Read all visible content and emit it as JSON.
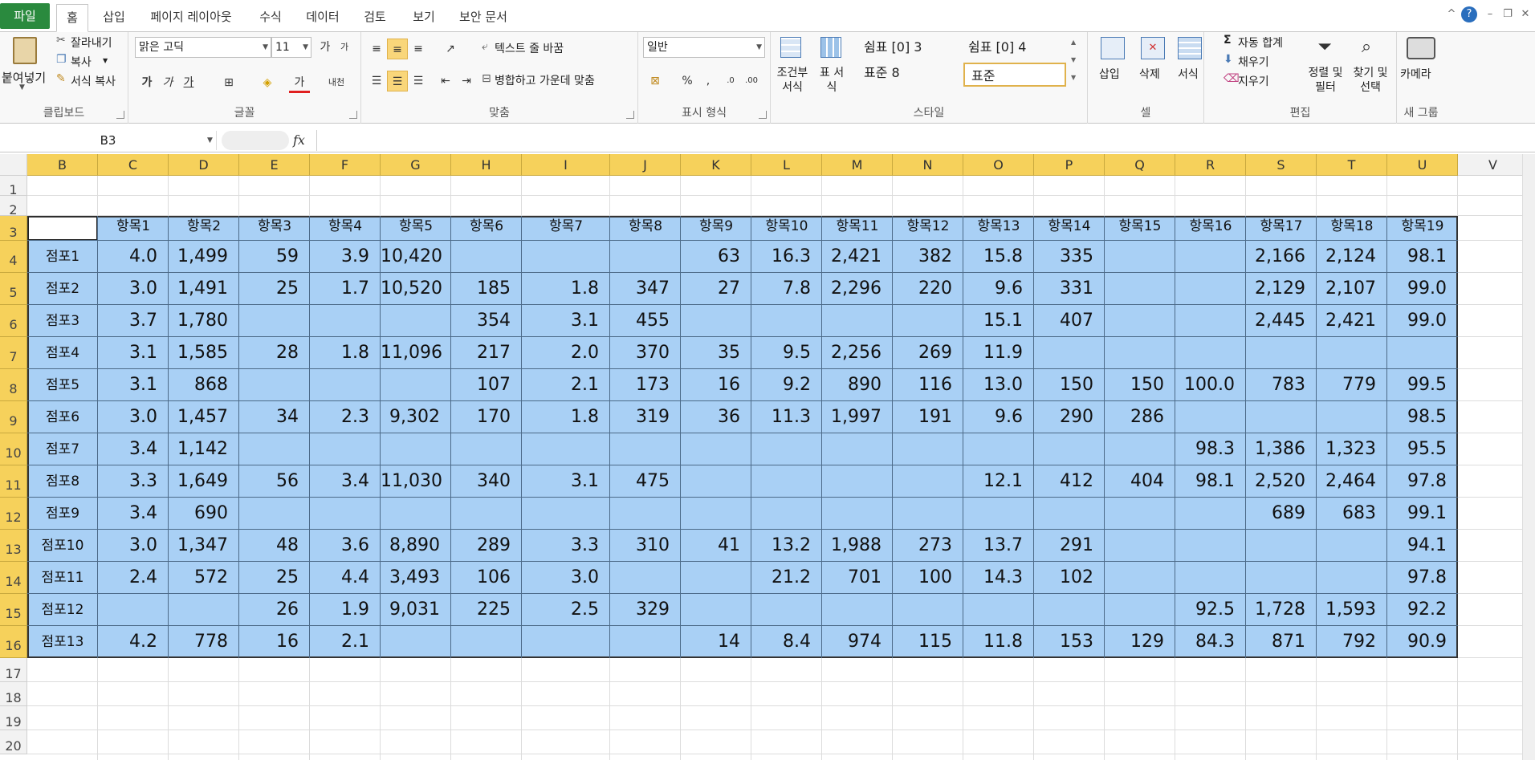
{
  "tabs": [
    "파일",
    "홈",
    "삽입",
    "페이지 레이아웃",
    "수식",
    "데이터",
    "검토",
    "보기",
    "보안 문서"
  ],
  "ribbon": {
    "clipboard": {
      "paste": "붙여넣기",
      "cut": "잘라내기",
      "copy": "복사",
      "format_painter": "서식 복사",
      "label": "클립보드"
    },
    "font": {
      "name": "맑은 고딕",
      "size": "11",
      "label": "글꼴",
      "bold": "가",
      "italic": "가",
      "underline": "가",
      "font_color_glyph": "가",
      "phonetic": "내천"
    },
    "align": {
      "wrap": "텍스트 줄 바꿈",
      "merge": "병합하고 가운데 맞춤",
      "label": "맞춤"
    },
    "number": {
      "format": "일반",
      "percent": "%",
      "comma": ",",
      "label": "표시 형식"
    },
    "styles": {
      "cond": "조건부 서식",
      "table": "표 서식",
      "s1": "쉼표 [0] 3",
      "s2": "쉼표 [0] 4",
      "s3": "표준 8",
      "s4": "표준",
      "label": "스타일"
    },
    "cells": {
      "insert": "삽입",
      "delete": "삭제",
      "format": "서식",
      "label": "셀"
    },
    "edit": {
      "autosum": "자동 합계",
      "fill": "채우기",
      "clear": "지우기",
      "sort": "정렬 및 필터",
      "find": "찾기 및 선택",
      "label": "편집"
    },
    "newgroup": {
      "camera": "카메라",
      "label": "새 그룹"
    }
  },
  "formula": {
    "namebox": "B3",
    "fx": "fx",
    "value": ""
  },
  "columns": [
    "B",
    "C",
    "D",
    "E",
    "F",
    "G",
    "H",
    "I",
    "J",
    "K",
    "L",
    "M",
    "N",
    "O",
    "P",
    "Q",
    "R",
    "S",
    "T",
    "U",
    "V"
  ],
  "rows": [
    "1",
    "2",
    "3",
    "4",
    "5",
    "6",
    "7",
    "8",
    "9",
    "10",
    "11",
    "12",
    "13",
    "14",
    "15",
    "16",
    "17",
    "18",
    "19",
    "20"
  ],
  "header_row": [
    "",
    "항목1",
    "항목2",
    "항목3",
    "항목4",
    "항목5",
    "항목6",
    "항목7",
    "항목8",
    "항목9",
    "항목10",
    "항목11",
    "항목12",
    "항목13",
    "항목14",
    "항목15",
    "항목16",
    "항목17",
    "항목18",
    "항목19"
  ],
  "data_rows": [
    [
      "점포1",
      "4.0",
      "1,499",
      "59",
      "3.9",
      "10,420",
      "",
      "",
      "",
      "63",
      "16.3",
      "2,421",
      "382",
      "15.8",
      "335",
      "",
      "",
      "2,166",
      "2,124",
      "98.1"
    ],
    [
      "점포2",
      "3.0",
      "1,491",
      "25",
      "1.7",
      "10,520",
      "185",
      "1.8",
      "347",
      "27",
      "7.8",
      "2,296",
      "220",
      "9.6",
      "331",
      "",
      "",
      "2,129",
      "2,107",
      "99.0"
    ],
    [
      "점포3",
      "3.7",
      "1,780",
      "",
      "",
      "",
      "354",
      "3.1",
      "455",
      "",
      "",
      "",
      "",
      "15.1",
      "407",
      "",
      "",
      "2,445",
      "2,421",
      "99.0"
    ],
    [
      "점포4",
      "3.1",
      "1,585",
      "28",
      "1.8",
      "11,096",
      "217",
      "2.0",
      "370",
      "35",
      "9.5",
      "2,256",
      "269",
      "11.9",
      "",
      "",
      "",
      "",
      "",
      ""
    ],
    [
      "점포5",
      "3.1",
      "868",
      "",
      "",
      "",
      "107",
      "2.1",
      "173",
      "16",
      "9.2",
      "890",
      "116",
      "13.0",
      "150",
      "150",
      "100.0",
      "783",
      "779",
      "99.5"
    ],
    [
      "점포6",
      "3.0",
      "1,457",
      "34",
      "2.3",
      "9,302",
      "170",
      "1.8",
      "319",
      "36",
      "11.3",
      "1,997",
      "191",
      "9.6",
      "290",
      "286",
      "",
      "",
      "",
      "98.5"
    ],
    [
      "점포7",
      "3.4",
      "1,142",
      "",
      "",
      "",
      "",
      "",
      "",
      "",
      "",
      "",
      "",
      "",
      "",
      "",
      "98.3",
      "1,386",
      "1,323",
      "95.5"
    ],
    [
      "점포8",
      "3.3",
      "1,649",
      "56",
      "3.4",
      "11,030",
      "340",
      "3.1",
      "475",
      "",
      "",
      "",
      "",
      "12.1",
      "412",
      "404",
      "98.1",
      "2,520",
      "2,464",
      "97.8"
    ],
    [
      "점포9",
      "3.4",
      "690",
      "",
      "",
      "",
      "",
      "",
      "",
      "",
      "",
      "",
      "",
      "",
      "",
      "",
      "",
      "689",
      "683",
      "99.1"
    ],
    [
      "점포10",
      "3.0",
      "1,347",
      "48",
      "3.6",
      "8,890",
      "289",
      "3.3",
      "310",
      "41",
      "13.2",
      "1,988",
      "273",
      "13.7",
      "291",
      "",
      "",
      "",
      "",
      "94.1"
    ],
    [
      "점포11",
      "2.4",
      "572",
      "25",
      "4.4",
      "3,493",
      "106",
      "3.0",
      "",
      "",
      "21.2",
      "701",
      "100",
      "14.3",
      "102",
      "",
      "",
      "",
      "",
      "97.8"
    ],
    [
      "점포12",
      "",
      "",
      "26",
      "1.9",
      "9,031",
      "225",
      "2.5",
      "329",
      "",
      "",
      "",
      "",
      "",
      "",
      "",
      "92.5",
      "1,728",
      "1,593",
      "92.2"
    ],
    [
      "점포13",
      "4.2",
      "778",
      "16",
      "2.1",
      "",
      "",
      "",
      "",
      "14",
      "8.4",
      "974",
      "115",
      "11.8",
      "153",
      "129",
      "84.3",
      "871",
      "792",
      "90.9"
    ]
  ],
  "colors": {
    "table_fill": "#a9d0f5",
    "header_fill": "#f6d15b",
    "file_tab": "#2a8a3e"
  }
}
